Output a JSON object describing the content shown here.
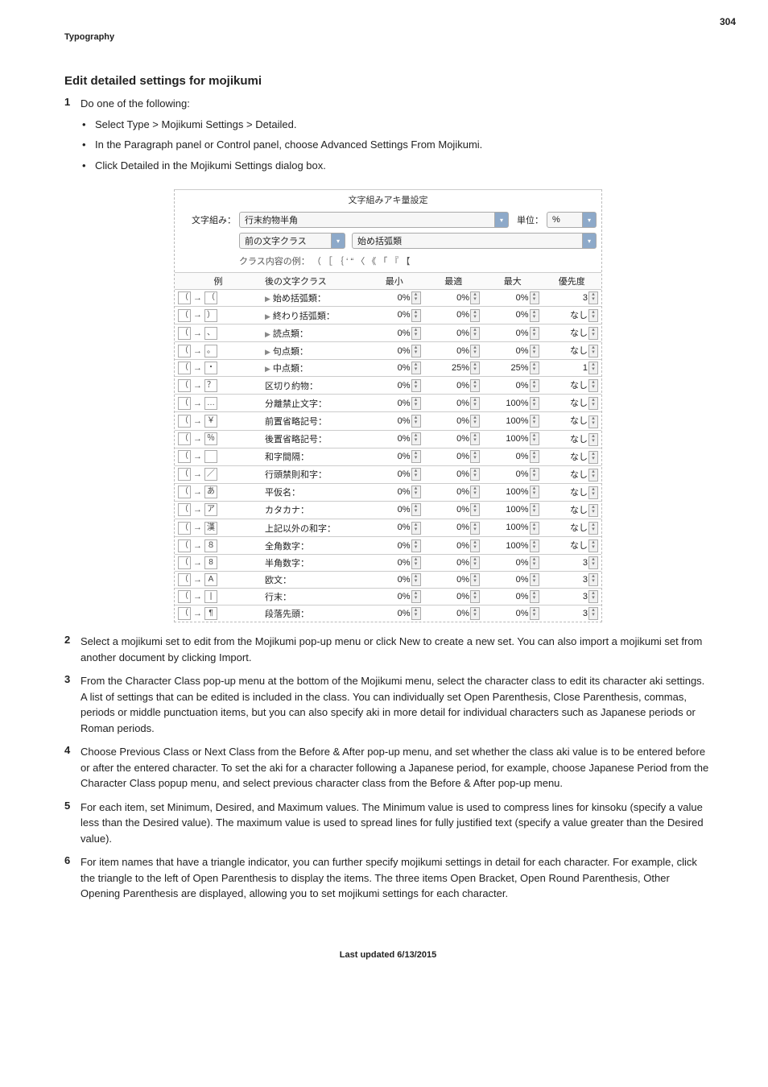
{
  "page_number": "304",
  "section_label": "Typography",
  "heading": "Edit detailed settings for mojikumi",
  "step1": {
    "intro": "Do one of the following:",
    "bullets": [
      "Select Type > Mojikumi Settings > Detailed.",
      "In the Paragraph panel or Control panel, choose Advanced Settings From Mojikumi.",
      "Click Detailed in the Mojikumi Settings dialog box."
    ]
  },
  "figure": {
    "title": "文字組みアキ量設定",
    "mojikumi_label": "文字組み：",
    "mojikumi_value": "行末約物半角",
    "unit_label": "単位：",
    "unit_value": "%",
    "prev_class_lbl": "前の文字クラス",
    "start_paren": "始め括弧類",
    "class_example_lbl": "クラス内容の例：",
    "class_example_val": "（ ［ ｛ ‘  “ 〈 《 「 『 【",
    "cols": {
      "example": "例",
      "next_class": "後の文字クラス",
      "min": "最小",
      "opt": "最適",
      "max": "最大",
      "pri": "優先度"
    },
    "rows": [
      {
        "g1": "（",
        "g2": "（",
        "tri": true,
        "label": "始め括弧類：",
        "min": "0%",
        "opt": "0%",
        "max": "0%",
        "pri": "3"
      },
      {
        "g1": "（",
        "g2": "）",
        "tri": true,
        "label": "終わり括弧類：",
        "min": "0%",
        "opt": "0%",
        "max": "0%",
        "pri": "なし"
      },
      {
        "g1": "（",
        "g2": "、",
        "tri": true,
        "label": "読点類：",
        "min": "0%",
        "opt": "0%",
        "max": "0%",
        "pri": "なし"
      },
      {
        "g1": "（",
        "g2": "。",
        "tri": true,
        "label": "句点類：",
        "min": "0%",
        "opt": "0%",
        "max": "0%",
        "pri": "なし"
      },
      {
        "g1": "（",
        "g2": "・",
        "tri": true,
        "label": "中点類：",
        "min": "0%",
        "opt": "25%",
        "max": "25%",
        "pri": "1"
      },
      {
        "g1": "（",
        "g2": "？",
        "tri": false,
        "label": "区切り約物：",
        "min": "0%",
        "opt": "0%",
        "max": "0%",
        "pri": "なし"
      },
      {
        "g1": "（",
        "g2": "…",
        "tri": false,
        "label": "分離禁止文字：",
        "min": "0%",
        "opt": "0%",
        "max": "100%",
        "pri": "なし"
      },
      {
        "g1": "（",
        "g2": "￥",
        "tri": false,
        "label": "前置省略記号：",
        "min": "0%",
        "opt": "0%",
        "max": "100%",
        "pri": "なし"
      },
      {
        "g1": "（",
        "g2": "％",
        "tri": false,
        "label": "後置省略記号：",
        "min": "0%",
        "opt": "0%",
        "max": "100%",
        "pri": "なし"
      },
      {
        "g1": "（",
        "g2": " ",
        "tri": false,
        "label": "和字間隔：",
        "min": "0%",
        "opt": "0%",
        "max": "0%",
        "pri": "なし"
      },
      {
        "g1": "（",
        "g2": "／",
        "tri": false,
        "label": "行頭禁則和字：",
        "min": "0%",
        "opt": "0%",
        "max": "0%",
        "pri": "なし"
      },
      {
        "g1": "（",
        "g2": "あ",
        "tri": false,
        "label": "平仮名：",
        "min": "0%",
        "opt": "0%",
        "max": "100%",
        "pri": "なし"
      },
      {
        "g1": "（",
        "g2": "ア",
        "tri": false,
        "label": "カタカナ：",
        "min": "0%",
        "opt": "0%",
        "max": "100%",
        "pri": "なし"
      },
      {
        "g1": "（",
        "g2": "漢",
        "tri": false,
        "label": "上記以外の和字：",
        "min": "0%",
        "opt": "0%",
        "max": "100%",
        "pri": "なし"
      },
      {
        "g1": "（",
        "g2": "８",
        "tri": false,
        "label": "全角数字：",
        "min": "0%",
        "opt": "0%",
        "max": "100%",
        "pri": "なし"
      },
      {
        "g1": "（",
        "g2": "8",
        "tri": false,
        "label": "半角数字：",
        "min": "0%",
        "opt": "0%",
        "max": "0%",
        "pri": "3"
      },
      {
        "g1": "（",
        "g2": "A",
        "tri": false,
        "label": "欧文：",
        "min": "0%",
        "opt": "0%",
        "max": "0%",
        "pri": "3"
      },
      {
        "g1": "（",
        "g2": "|",
        "tri": false,
        "label": "行末：",
        "min": "0%",
        "opt": "0%",
        "max": "0%",
        "pri": "3"
      },
      {
        "g1": "（",
        "g2": "¶",
        "tri": false,
        "label": "段落先頭：",
        "min": "0%",
        "opt": "0%",
        "max": "0%",
        "pri": "3"
      }
    ]
  },
  "step2": "Select a mojikumi set to edit from the Mojikumi pop-up menu or click New to create a new set. You can also import a mojikumi set from another document by clicking Import.",
  "step3": "From the Character Class pop-up menu at the bottom of the Mojikumi menu, select the character class to edit its character aki settings. A list of settings that can be edited is included in the class. You can individually set Open Parenthesis, Close Parenthesis, commas, periods or middle punctuation items, but you can also specify aki in more detail for individual characters such as Japanese periods or Roman periods.",
  "step4": "Choose Previous Class or Next Class from the Before & After pop-up menu, and set whether the class aki value is to be entered before or after the entered character. To set the aki for a character following a Japanese period, for example, choose Japanese Period from the Character Class popup menu, and select previous character class from the Before & After pop-up menu.",
  "step5": "For each item, set Minimum, Desired, and Maximum values. The Minimum value is used to compress lines for kinsoku (specify a value less than the Desired value). The maximum value is used to spread lines for fully justified text (specify a value greater than the Desired value).",
  "step6": "For item names that have a triangle indicator, you can further specify mojikumi settings in detail for each character. For example, click the triangle to the left of Open Parenthesis to display the items. The three items Open Bracket, Open Round Parenthesis, Other Opening Parenthesis are displayed, allowing you to set mojikumi settings for each character.",
  "footer": "Last updated 6/13/2015"
}
